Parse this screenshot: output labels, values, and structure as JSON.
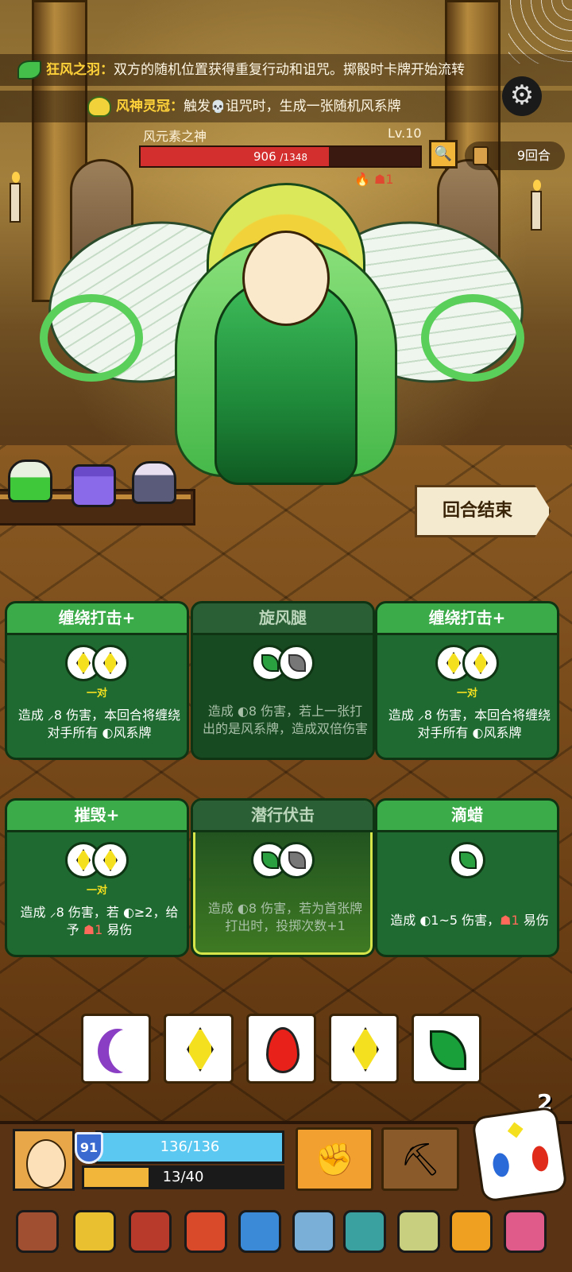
{
  "banners": {
    "relic1_name": "狂风之羽",
    "relic1_sep": "：",
    "relic1_text": "双方的随机位置获得重复行动和诅咒。掷骰时卡牌开始流转",
    "relic2_name": "风神灵冠",
    "relic2_sep": "：",
    "relic2_text_a": "触发",
    "relic2_icon": "💀",
    "relic2_text_b": "诅咒时，生成一张随机风系牌"
  },
  "boss": {
    "name": "风元素之神",
    "level": "Lv.10",
    "hp_current": "906",
    "hp_max": "/1348",
    "hp_fraction": 0.672,
    "status": "🔥 ☗1"
  },
  "round": {
    "label": "9回合"
  },
  "end_turn_label": "回合结束",
  "cards": [
    {
      "title": "缠绕打击+",
      "pair": "一对",
      "desc": "造成 ⸝8 伤害，本回合将缠绕对手所有 ◐风系牌"
    },
    {
      "title": "旋风腿",
      "desc": "造成 ◐8 伤害，若上一张打出的是风系牌，造成双倍伤害"
    },
    {
      "title": "缠绕打击+",
      "pair": "一对",
      "desc": "造成 ⸝8 伤害，本回合将缠绕对手所有 ◐风系牌"
    },
    {
      "title": "摧毁+",
      "pair": "一对",
      "desc_a": "造成 ⸝8 伤害，若 ◐≥2，给予 ",
      "desc_tag": "☗1",
      "desc_b": " 易伤"
    },
    {
      "title": "潜行伏击",
      "desc": "造成 ◐8 伤害，若为首张牌打出时，投掷次数+1"
    },
    {
      "title": "滴蜡",
      "desc_a": "造成 ◐1~5 伤害，",
      "desc_tag": "☗1",
      "desc_b": " 易伤"
    }
  ],
  "dice_tray": [
    "moon",
    "diamond",
    "flame",
    "diamond",
    "leaf"
  ],
  "dice_count": "2",
  "player": {
    "shield": "91",
    "hp": "136/136",
    "xp": "13/40",
    "xp_fraction": 0.325
  },
  "icons": {
    "gear": "⚙",
    "inspect": "🔍",
    "fist": "✊",
    "dig": "⛏"
  },
  "colors": {
    "accent_green": "#3aab48",
    "hp_red": "#d42f2f",
    "shield_blue": "#5ac8f0",
    "xp_orange": "#f2b63a"
  }
}
